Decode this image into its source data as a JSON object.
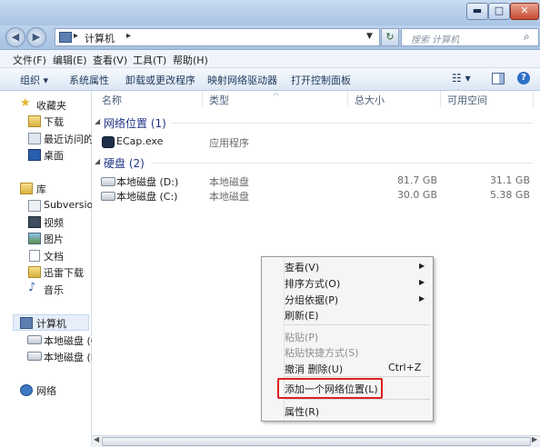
{
  "nav": {
    "address": "计算机",
    "search_placeholder": "搜索 计算机"
  },
  "window_buttons": {
    "minimize": "▬",
    "maximize": "□",
    "close": "✕"
  },
  "menubar": [
    "文件(F)",
    "编辑(E)",
    "查看(V)",
    "工具(T)",
    "帮助(H)"
  ],
  "toolbar": {
    "organize": "组织 ▾",
    "system_properties": "系统属性",
    "uninstall": "卸载或更改程序",
    "map_drive": "映射网络驱动器",
    "control_panel": "打开控制面板"
  },
  "sidebar": {
    "favorites": "收藏夹",
    "downloads": "下载",
    "recent": "最近访问的",
    "desktop": "桌面",
    "libraries": "库",
    "subversion": "Subversion",
    "videos": "视频",
    "pictures": "图片",
    "documents": "文档",
    "thunder": "迅雷下载",
    "music": "音乐",
    "computer": "计算机",
    "local_c": "本地磁盘 (C",
    "local_d": "本地磁盘 (D",
    "network": "网络"
  },
  "columns": {
    "name": "名称",
    "type": "类型",
    "total": "总大小",
    "free": "可用空间"
  },
  "groups": {
    "network": "网络位置 (1)",
    "disks": "硬盘 (2)"
  },
  "rows": {
    "ecap": {
      "name": "ECap.exe",
      "type": "应用程序"
    },
    "disk_d": {
      "name": "本地磁盘 (D:)",
      "type": "本地磁盘",
      "total": "81.7 GB",
      "free": "31.1 GB"
    },
    "disk_c": {
      "name": "本地磁盘 (C:)",
      "type": "本地磁盘",
      "total": "30.0 GB",
      "free": "5.38 GB"
    }
  },
  "context_menu": {
    "view": "查看(V)",
    "sort": "排序方式(O)",
    "group": "分组依据(P)",
    "refresh": "刷新(E)",
    "paste": "粘贴(P)",
    "paste_shortcut": "粘贴快捷方式(S)",
    "undo": "撤消 删除(U)",
    "undo_shortcut": "Ctrl+Z",
    "add_network": "添加一个网络位置(L)",
    "properties": "属性(R)"
  }
}
